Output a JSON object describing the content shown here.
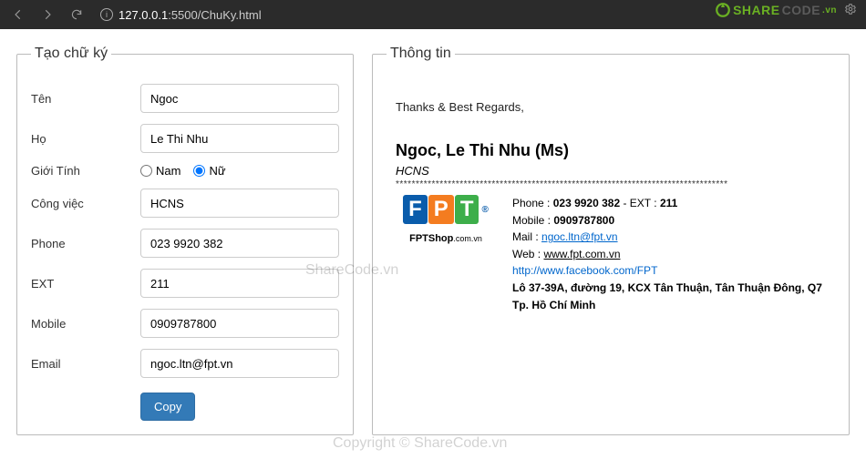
{
  "browser": {
    "url_host": "127.0.0.1",
    "url_path": ":5500/ChuKy.html"
  },
  "brand": {
    "name_a": "SHARE",
    "name_b": "CODE",
    "tld": ".vn"
  },
  "form": {
    "legend": "Tạo chữ ký",
    "labels": {
      "firstname": "Tên",
      "lastname": "Họ",
      "gender": "Giới Tính",
      "job": "Công việc",
      "phone": "Phone",
      "ext": "EXT",
      "mobile": "Mobile",
      "email": "Email"
    },
    "gender_options": {
      "male": "Nam",
      "female": "Nữ"
    },
    "values": {
      "firstname": "Ngoc",
      "lastname": "Le Thi Nhu",
      "job": "HCNS",
      "phone": "023 9920 382",
      "ext": "211",
      "mobile": "0909787800",
      "email": "ngoc.ltn@fpt.vn"
    },
    "copy_button": "Copy"
  },
  "signature": {
    "legend": "Thông tin",
    "regards": "Thanks & Best Regards,",
    "fullname": "Ngoc, Le Thi Nhu (Ms)",
    "job": "HCNS",
    "separator": "***********************************************************************************",
    "logo_sub": "FPTShop",
    "logo_domain": ".com.vn",
    "details": {
      "phone_label": "Phone :",
      "phone_value": "023 9920 382",
      "ext_label": "- EXT :",
      "ext_value": "211",
      "mobile_label": "Mobile :",
      "mobile_value": "0909787800",
      "mail_label": "Mail :",
      "mail_value": "ngoc.ltn@fpt.vn",
      "web_label": "Web :",
      "web_value": "www.fpt.com.vn",
      "facebook": "http://www.facebook.com/FPT",
      "address1": "Lô 37-39A, đường 19, KCX Tân Thuận, Tân Thuận Đông, Q7",
      "address2": "Tp. Hồ Chí Minh"
    }
  },
  "watermark": {
    "a": "ShareCode.vn",
    "b": "Copyright © ShareCode.vn"
  }
}
